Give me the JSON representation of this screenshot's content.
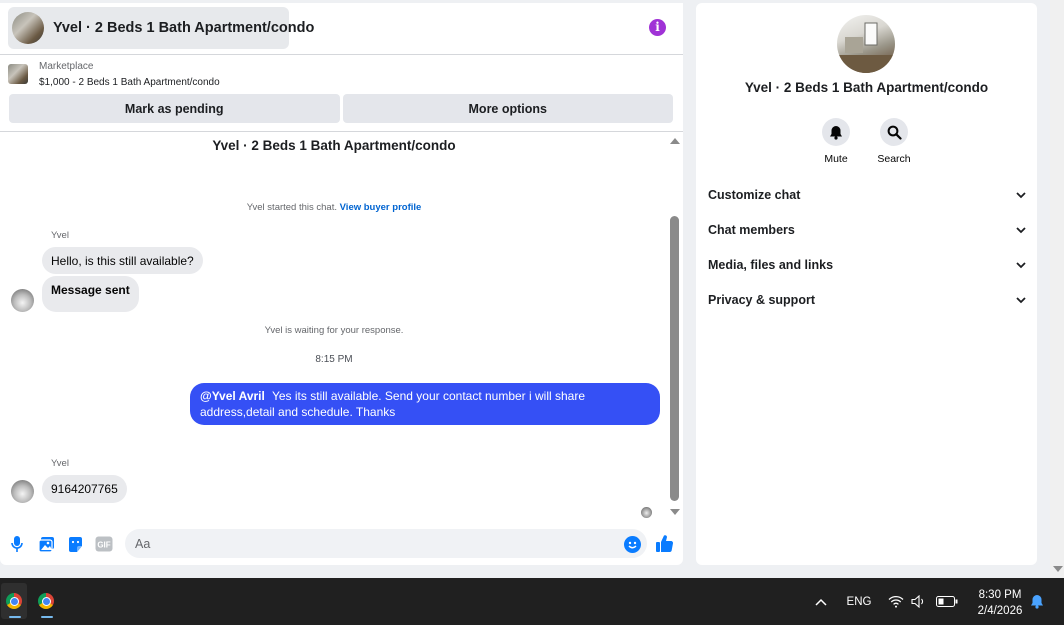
{
  "chat": {
    "header_title": "Yvel · 2 Beds 1 Bath Apartment/condo",
    "listing_source": "Marketplace",
    "listing_detail": "$1,000 - 2 Beds 1 Bath Apartment/condo",
    "actions": {
      "mark_pending": "Mark as pending",
      "more_options": "More options"
    }
  },
  "thread": {
    "title": "Yvel · 2 Beds 1 Bath Apartment/condo",
    "started_text": "Yvel started this chat.",
    "view_profile": "View buyer profile",
    "sender_name_1": "Yvel",
    "msg_1": "Hello, is this still available?",
    "msg_2": "Message sent",
    "waiting_text": "Yvel is waiting for your response.",
    "time": "8:15 PM",
    "out_mention": "@Yvel Avril",
    "out_text": "Yes its still available. Send your contact number i will share address,detail and schedule. Thanks",
    "sender_name_2": "Yvel",
    "msg_3": "9164207765"
  },
  "composer": {
    "placeholder": "Aa"
  },
  "side": {
    "title": "Yvel · 2 Beds 1 Bath Apartment/condo",
    "mute_label": "Mute",
    "search_label": "Search",
    "sections": [
      "Customize chat",
      "Chat members",
      "Media, files and links",
      "Privacy & support"
    ]
  },
  "taskbar": {
    "lang": "ENG",
    "time": "8:30 PM",
    "date": "2/4/2026"
  },
  "colors": {
    "accent_blue": "#0a7cff",
    "outgoing_bubble": "#3550f5",
    "info_purple": "#a032d6"
  }
}
